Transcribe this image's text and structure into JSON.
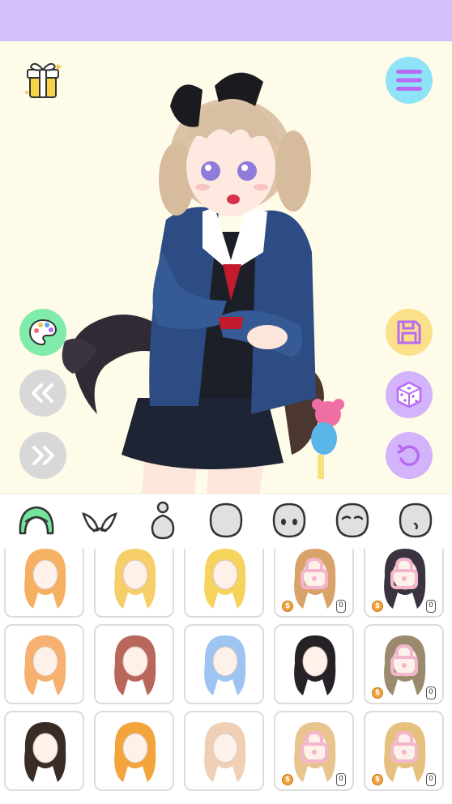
{
  "colors": {
    "top_bar": "#d3c2f9",
    "stage_bg": "#fffbe9",
    "menu_btn": "#8fe3f6",
    "palette_btn": "#7fecac",
    "nav_btn": "#d8d8d8",
    "save_btn": "#fbe08a",
    "random_btn": "#d3b3fb",
    "undo_btn": "#d3b3fb",
    "active_tab": "#74e39c",
    "tab_icon": "#e0e0e0",
    "lock": "#f3b6cc",
    "coin": "#f0a23a"
  },
  "top_left": {
    "icon": "gift-icon"
  },
  "top_right": {
    "icon": "menu-icon"
  },
  "left_tools": [
    "palette-icon",
    "rewind-icon",
    "fast-forward-icon"
  ],
  "right_tools": [
    "save-icon",
    "dice-icon",
    "undo-icon"
  ],
  "category_tabs": [
    {
      "icon": "hair-icon",
      "active": true
    },
    {
      "icon": "ears-icon",
      "active": false
    },
    {
      "icon": "body-icon",
      "active": false
    },
    {
      "icon": "head-icon",
      "active": false
    },
    {
      "icon": "eyes-icon",
      "active": false
    },
    {
      "icon": "brows-icon",
      "active": false
    },
    {
      "icon": "mouth-icon",
      "active": false
    }
  ],
  "coin_symbol": "$",
  "hair_items": [
    {
      "color": "#f5b062",
      "locked": false,
      "price": ""
    },
    {
      "color": "#f7cf6a",
      "locked": false,
      "price": ""
    },
    {
      "color": "#f6d35c",
      "locked": false,
      "price": ""
    },
    {
      "color": "#d9a26a",
      "locked": true,
      "price": "0"
    },
    {
      "color": "#3b3440",
      "locked": true,
      "price": "0"
    },
    {
      "color": "#f6b070",
      "locked": false,
      "price": ""
    },
    {
      "color": "#b8675a",
      "locked": false,
      "price": ""
    },
    {
      "color": "#9ec4f2",
      "locked": false,
      "price": ""
    },
    {
      "color": "#262126",
      "locked": false,
      "price": ""
    },
    {
      "color": "#9a8b6e",
      "locked": true,
      "price": "0"
    },
    {
      "color": "#3a2b27",
      "locked": false,
      "price": ""
    },
    {
      "color": "#f3a43b",
      "locked": false,
      "price": ""
    },
    {
      "color": "#efd0b4",
      "locked": false,
      "price": ""
    },
    {
      "color": "#e8c48e",
      "locked": true,
      "price": "0"
    },
    {
      "color": "#e6c07e",
      "locked": true,
      "price": "0"
    }
  ]
}
